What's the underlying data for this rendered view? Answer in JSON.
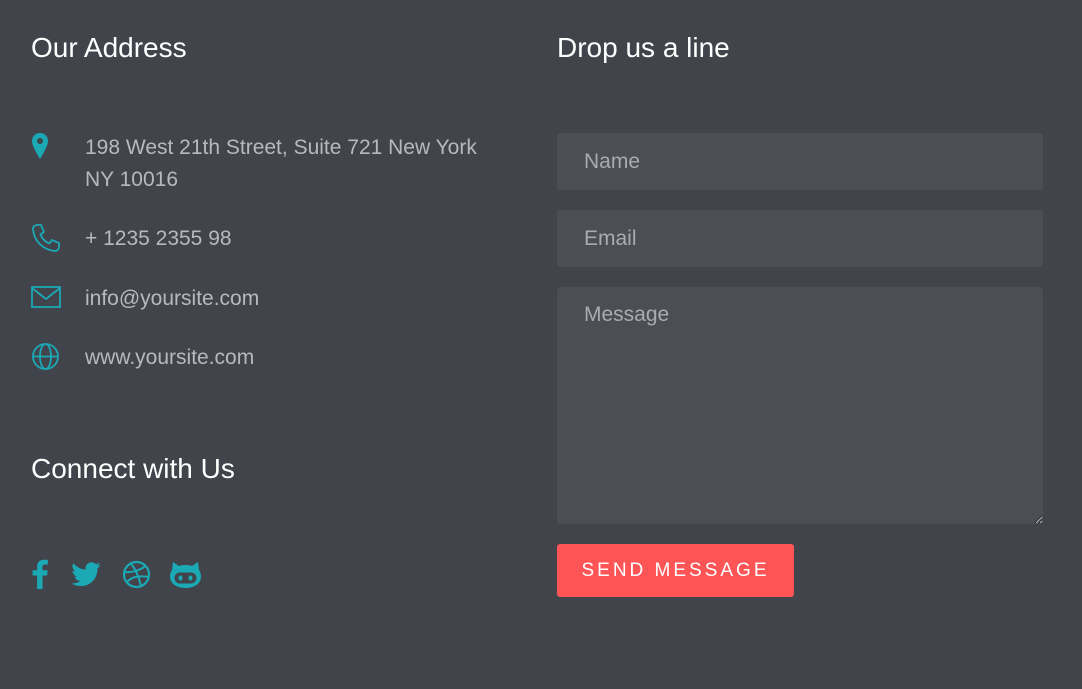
{
  "address": {
    "title": "Our Address",
    "items": [
      {
        "icon": "map-pin-icon",
        "text": "198 West 21th Street, Suite 721 New York NY 10016"
      },
      {
        "icon": "phone-icon",
        "text": "+ 1235 2355 98"
      },
      {
        "icon": "mail-icon",
        "text": "info@yoursite.com"
      },
      {
        "icon": "globe-icon",
        "text": "www.yoursite.com"
      }
    ]
  },
  "connect": {
    "title": "Connect with Us",
    "social": [
      "facebook-icon",
      "twitter-icon",
      "dribbble-icon",
      "github-icon"
    ]
  },
  "form": {
    "title": "Drop us a line",
    "name_placeholder": "Name",
    "email_placeholder": "Email",
    "message_placeholder": "Message",
    "submit_label": "SEND MESSAGE"
  },
  "colors": {
    "background": "#41444b",
    "accent": "#1aa9b5",
    "button": "#fd5456",
    "field": "#4b4e55"
  }
}
